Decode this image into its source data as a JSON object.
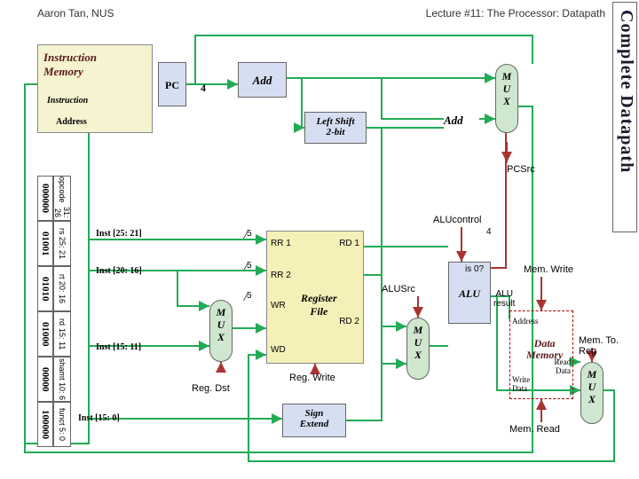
{
  "header": {
    "author": "Aaron Tan, NUS",
    "lecture": "Lecture #11: The Processor: Datapath"
  },
  "side_title": "Complete Datapath",
  "imem": {
    "line1": "Instruction",
    "line2": "Memory",
    "port": "Instruction",
    "addr": "Address"
  },
  "pc": "PC",
  "const4": "4",
  "add": "Add",
  "lshift": {
    "l1": "Left Shift",
    "l2": "2-bit"
  },
  "mux": "M\nU\nX",
  "pcsrc": "PCSrc",
  "fields": [
    {
      "bits": "000000",
      "name": "opcode",
      "range": "31: 26"
    },
    {
      "bits": "01001",
      "name": "rs",
      "range": "25: 21"
    },
    {
      "bits": "01010",
      "name": "rt",
      "range": "20: 16"
    },
    {
      "bits": "01000",
      "name": "rd",
      "range": "15: 11"
    },
    {
      "bits": "00000",
      "name": "shamt",
      "range": "10: 6"
    },
    {
      "bits": "100000",
      "name": "funct",
      "range": "5: 0"
    }
  ],
  "bit_labels": {
    "i2521": "Inst [25: 21]",
    "i2016": "Inst [20: 16]",
    "i1511": "Inst [15: 11]",
    "i150": "Inst [15: 0]"
  },
  "regfile": {
    "rr1": "RR 1",
    "rr2": "RR 2",
    "wr": "WR",
    "wd": "WD",
    "rd1": "RD 1",
    "rd2": "RD 2",
    "title1": "Register",
    "title2": "File"
  },
  "regwrite": "Reg. Write",
  "regdst": "Reg. Dst",
  "signext": {
    "l1": "Sign",
    "l2": "Extend"
  },
  "alu": "ALU",
  "alusrc": "ALUSrc",
  "alucontrol": "ALUcontrol",
  "alufour": "4",
  "is0": "is 0?",
  "alures": {
    "l1": "ALU",
    "l2": "result"
  },
  "memwrite": "Mem. Write",
  "dmem": {
    "title1": "Data",
    "title2": "Memory",
    "addr": "Address",
    "wd1": "Write",
    "wd2": "Data",
    "rd1": "Read",
    "rd2": "Data"
  },
  "memread": "Mem. Read",
  "memtoreg": "Mem. To. Reg",
  "bus5": "5"
}
